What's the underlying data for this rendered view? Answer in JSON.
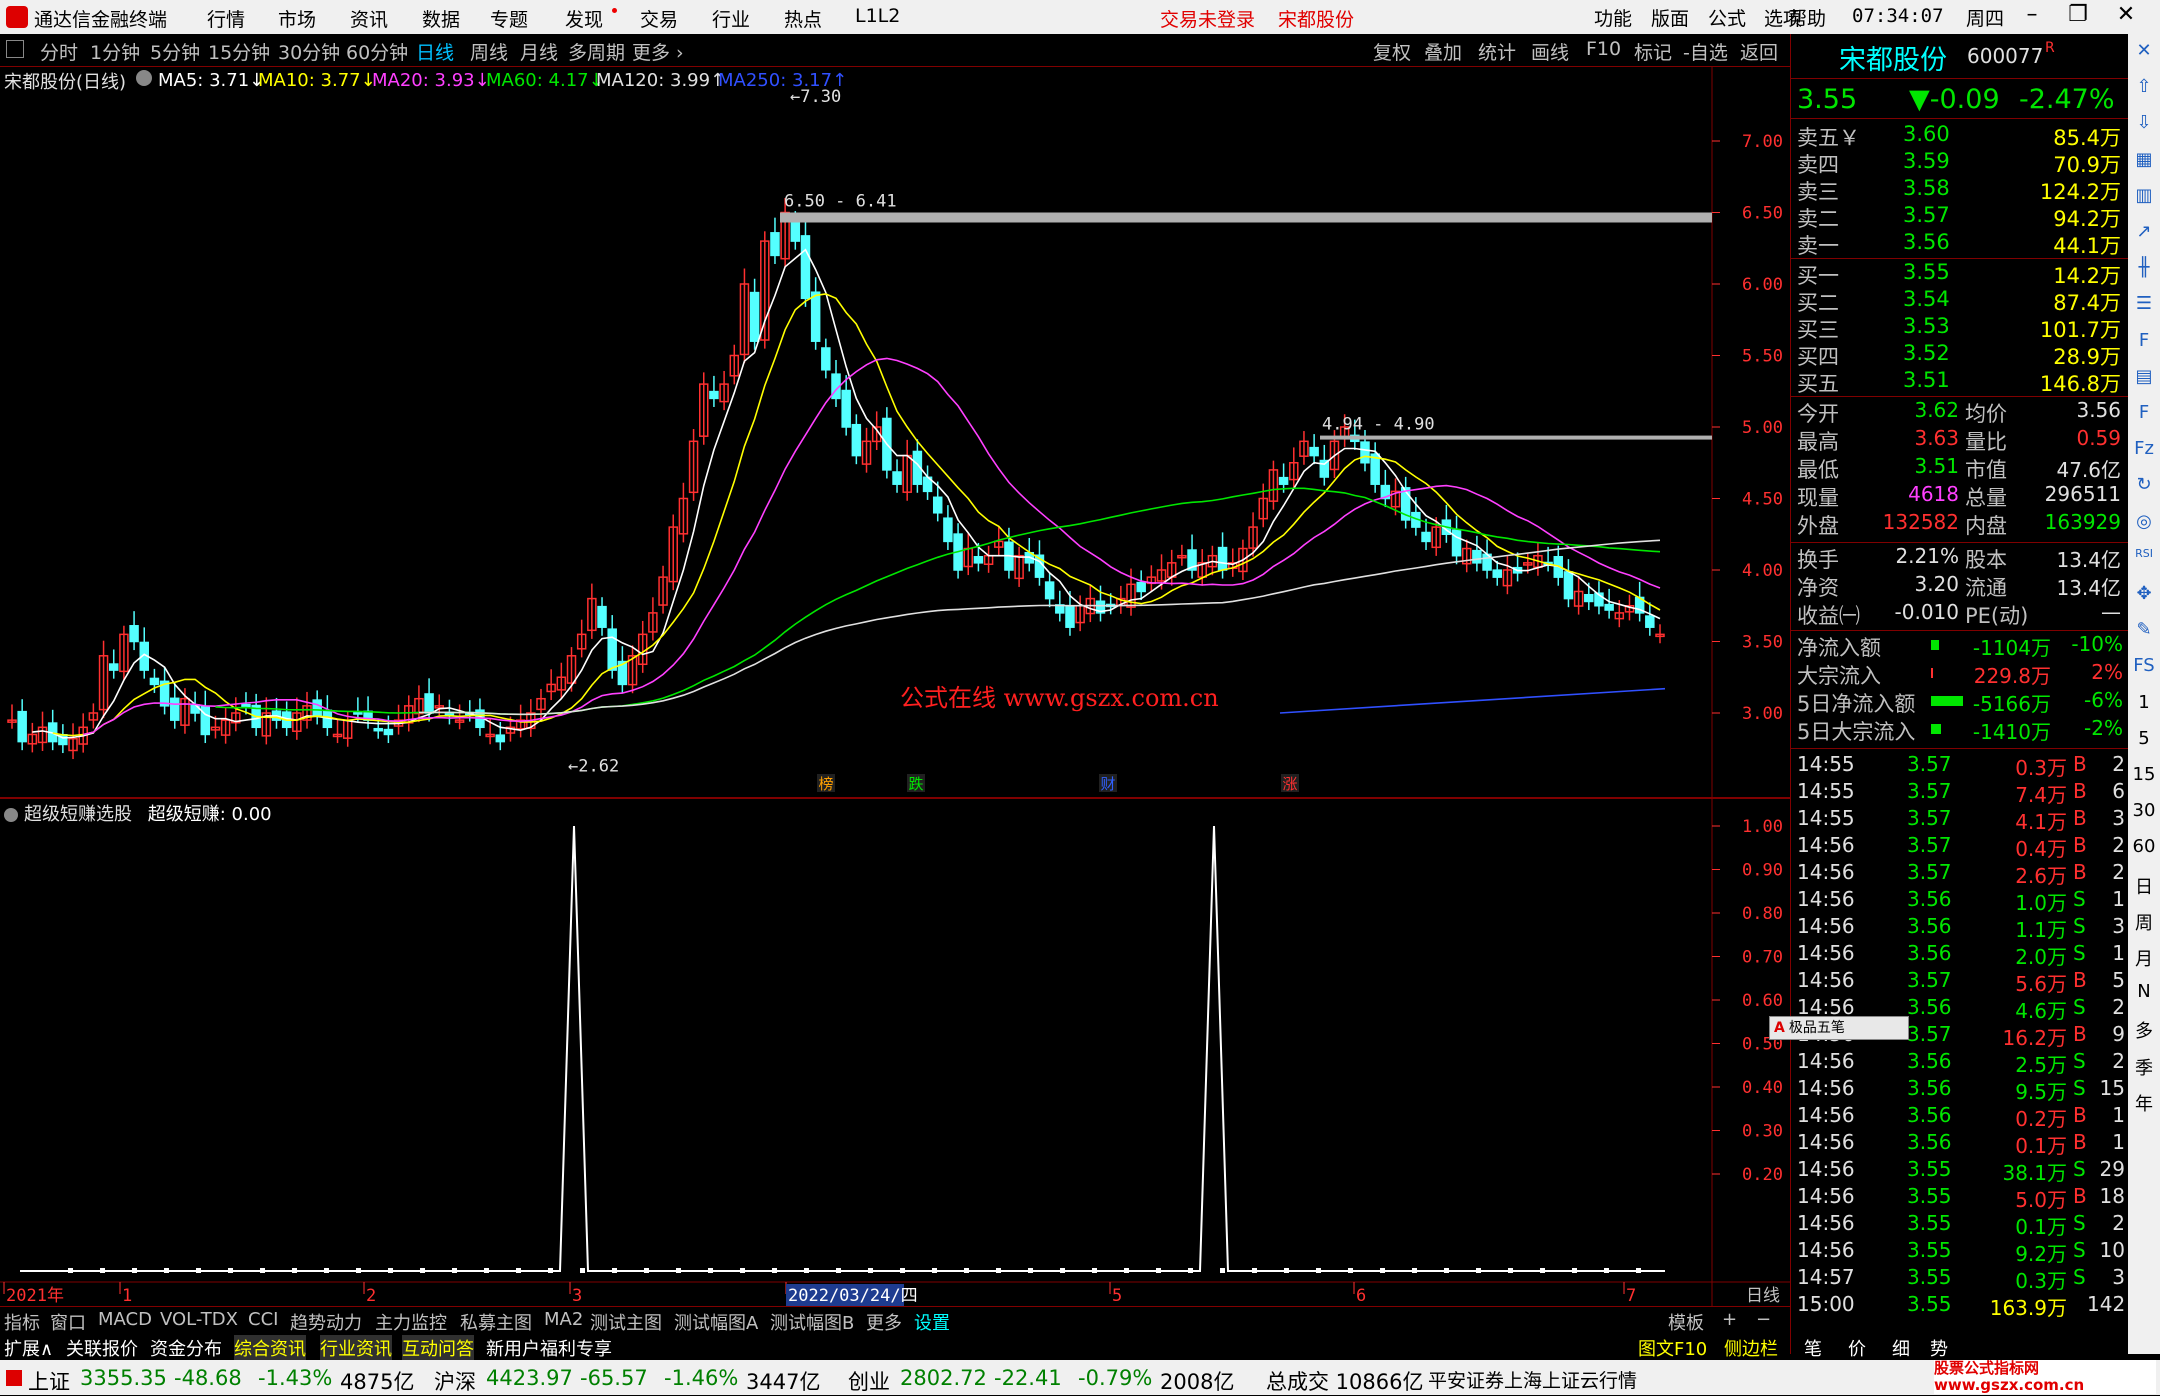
{
  "app": {
    "title": "通达信金融终端",
    "menu": [
      "行情",
      "市场",
      "资讯",
      "数据",
      "专题",
      "发现",
      "交易",
      "行业",
      "热点",
      "L1L2"
    ],
    "status_red": [
      "交易未登录",
      "宋都股份"
    ],
    "sys_menu": [
      "功能",
      "版面",
      "公式",
      "选项",
      "帮助"
    ],
    "clock": "07:34:07",
    "weekday": "周四"
  },
  "toolbar": {
    "periods": [
      "分时",
      "1分钟",
      "5分钟",
      "15分钟",
      "30分钟",
      "60分钟",
      "日线",
      "周线",
      "月线",
      "多周期",
      "更多"
    ],
    "active": "日线",
    "right": [
      "复权",
      "叠加",
      "统计",
      "画线",
      "F10",
      "标记",
      "-自选",
      "返回"
    ]
  },
  "ma_line": {
    "title": "宋都股份(日线)",
    "items": [
      {
        "label": "MA5: 3.71↓",
        "color": "#ffffff"
      },
      {
        "label": "MA10: 3.77↓",
        "color": "#ffff00"
      },
      {
        "label": "MA20: 3.93↓",
        "color": "#ff40ff"
      },
      {
        "label": "MA60: 4.17↓",
        "color": "#00e600"
      },
      {
        "label": "MA120: 3.99↑",
        "color": "#e0e0e0"
      },
      {
        "label": "MA250: 3.17↑",
        "color": "#3050ff"
      }
    ]
  },
  "price_axis": [
    "7.00",
    "6.50",
    "6.00",
    "5.50",
    "5.00",
    "4.50",
    "4.00",
    "3.50",
    "3.00"
  ],
  "annotations": {
    "high": "7.30",
    "low": "2.62",
    "range1": "6.50 - 6.41",
    "range2": "4.94 - 4.90",
    "watermark": "公式在线  www.gszx.com.cn"
  },
  "event_markers": [
    {
      "t": "榜",
      "c": "#ffa000"
    },
    {
      "t": "跌",
      "c": "#00e600"
    },
    {
      "t": "财",
      "c": "#3060ff"
    },
    {
      "t": "涨",
      "c": "#ff3030"
    }
  ],
  "indicator": {
    "title": "超级短赚选股",
    "label": "超级短赚: 0.00",
    "axis": [
      "1.00",
      "0.90",
      "0.80",
      "0.70",
      "0.60",
      "0.50",
      "0.40",
      "0.30",
      "0.20"
    ]
  },
  "date_axis": {
    "labels": [
      "2021年",
      "1",
      "2",
      "3",
      "2022/03/24/四",
      "5",
      "6",
      "7"
    ],
    "period": "日线"
  },
  "tabs": [
    "指标",
    "窗口",
    "MACD",
    "VOL-TDX",
    "CCI",
    "趋势动力",
    "主力监控",
    "私募主图",
    "MA2",
    "测试主图",
    "测试幅图A",
    "测试幅图B",
    "更多",
    "设置"
  ],
  "tabs_right": [
    "模板",
    "+",
    "−"
  ],
  "ext": [
    "扩展∧",
    "关联报价",
    "资金分布",
    "综合资讯",
    "行业资讯",
    "互动问答",
    "新用户福利专享"
  ],
  "ext_right": [
    "图文F10",
    "侧边栏《",
    "笔",
    "价",
    "细",
    "势"
  ],
  "quote": {
    "name": "宋都股份",
    "code": "600077",
    "tag": "R",
    "price": "3.55",
    "change": "▼-0.09",
    "pct": "-2.47%",
    "asks": [
      {
        "l": "卖五￥",
        "p": "3.60",
        "v": "85.4万"
      },
      {
        "l": "卖四",
        "p": "3.59",
        "v": "70.9万"
      },
      {
        "l": "卖三",
        "p": "3.58",
        "v": "124.2万"
      },
      {
        "l": "卖二",
        "p": "3.57",
        "v": "94.2万"
      },
      {
        "l": "卖一",
        "p": "3.56",
        "v": "44.1万"
      }
    ],
    "bids": [
      {
        "l": "买一",
        "p": "3.55",
        "v": "14.2万"
      },
      {
        "l": "买二",
        "p": "3.54",
        "v": "87.4万"
      },
      {
        "l": "买三",
        "p": "3.53",
        "v": "101.7万"
      },
      {
        "l": "买四",
        "p": "3.52",
        "v": "28.9万"
      },
      {
        "l": "买五",
        "p": "3.51",
        "v": "146.8万"
      }
    ],
    "stats": [
      [
        "今开",
        "3.62",
        "均价",
        "3.56"
      ],
      [
        "最高",
        "3.63",
        "量比",
        "0.59"
      ],
      [
        "最低",
        "3.51",
        "市值",
        "47.6亿"
      ],
      [
        "现量",
        "4618",
        "总量",
        "296511"
      ],
      [
        "外盘",
        "132582",
        "内盘",
        "163929"
      ]
    ],
    "stats2": [
      [
        "换手",
        "2.21%",
        "股本",
        "13.4亿"
      ],
      [
        "净资",
        "3.20",
        "流通",
        "13.4亿"
      ],
      [
        "收益㈠",
        "-0.010",
        "PE(动)",
        "—"
      ]
    ],
    "flows": [
      [
        "净流入额",
        "-1104万",
        "-10%"
      ],
      [
        "大宗流入",
        "229.8万",
        "2%"
      ],
      [
        "5日净流入额",
        "-5166万",
        "-6%"
      ],
      [
        "5日大宗流入",
        "-1410万",
        "-2%"
      ]
    ],
    "ticks": [
      [
        "14:55",
        "3.57",
        "0.3万",
        "B",
        "2"
      ],
      [
        "14:55",
        "3.57",
        "7.4万",
        "B",
        "6"
      ],
      [
        "14:55",
        "3.57",
        "4.1万",
        "B",
        "3"
      ],
      [
        "14:56",
        "3.57",
        "0.4万",
        "B",
        "2"
      ],
      [
        "14:56",
        "3.57",
        "2.6万",
        "B",
        "2"
      ],
      [
        "14:56",
        "3.56",
        "1.0万",
        "S",
        "1"
      ],
      [
        "14:56",
        "3.56",
        "1.1万",
        "S",
        "3"
      ],
      [
        "14:56",
        "3.56",
        "2.0万",
        "S",
        "1"
      ],
      [
        "14:56",
        "3.57",
        "5.6万",
        "B",
        "5"
      ],
      [
        "14:56",
        "3.56",
        "4.6万",
        "S",
        "2"
      ],
      [
        "14:56",
        "3.57",
        "16.2万",
        "B",
        "9"
      ],
      [
        "14:56",
        "3.56",
        "2.5万",
        "S",
        "2"
      ],
      [
        "14:56",
        "3.56",
        "9.5万",
        "S",
        "15"
      ],
      [
        "14:56",
        "3.56",
        "0.2万",
        "B",
        "1"
      ],
      [
        "14:56",
        "3.56",
        "0.1万",
        "B",
        "1"
      ],
      [
        "14:56",
        "3.55",
        "38.1万",
        "S",
        "29"
      ],
      [
        "14:56",
        "3.55",
        "5.0万",
        "B",
        "18"
      ],
      [
        "14:56",
        "3.55",
        "0.1万",
        "S",
        "2"
      ],
      [
        "14:56",
        "3.55",
        "9.2万",
        "S",
        "10"
      ],
      [
        "14:57",
        "3.55",
        "0.3万",
        "S",
        "3"
      ],
      [
        "15:00",
        "3.55",
        "163.9万",
        "",
        "142"
      ]
    ],
    "ime": "极品五笔"
  },
  "side_icons": [
    "close-icon",
    "up-icon",
    "down-icon",
    "grid-icon",
    "bar-icon",
    "chart-icon",
    "kline-icon",
    "list-icon",
    "f10-icon",
    "table-icon",
    "f-icon",
    "fz-icon",
    "sync-icon",
    "target-icon",
    "rsi-icon",
    "move-icon",
    "pen-icon",
    "fs-icon",
    "1",
    "5",
    "15",
    "30",
    "60",
    "日",
    "周",
    "月",
    "N",
    "多",
    "季",
    "年"
  ],
  "statusbar": [
    {
      "name": "上证",
      "v": "3355.35",
      "c": "-48.68",
      "p": "-1.43%",
      "a": "4875亿"
    },
    {
      "name": "沪深",
      "v": "4423.97",
      "c": "-65.57",
      "p": "-1.46%",
      "a": "3447亿"
    },
    {
      "name": "创业",
      "v": "2802.72",
      "c": "-22.41",
      "p": "-0.79%",
      "a": "2008亿"
    }
  ],
  "status_total": "总成交 10866亿",
  "status_note": "平安证券上海上证云行情",
  "brand": "股票公式指标网 www.gszx.com.cn",
  "chart_data": {
    "type": "candlestick",
    "ma_values": {
      "MA5": 3.71,
      "MA10": 3.77,
      "MA20": 3.93,
      "MA60": 4.17,
      "MA120": 3.99,
      "MA250": 3.17
    },
    "price_ylim": [
      2.55,
      7.45
    ],
    "indicator_signals": [
      {
        "index": 18,
        "value": 1.0
      },
      {
        "index": 38,
        "value": 1.0
      }
    ],
    "indicator_ylim": [
      0,
      1.0
    ]
  }
}
